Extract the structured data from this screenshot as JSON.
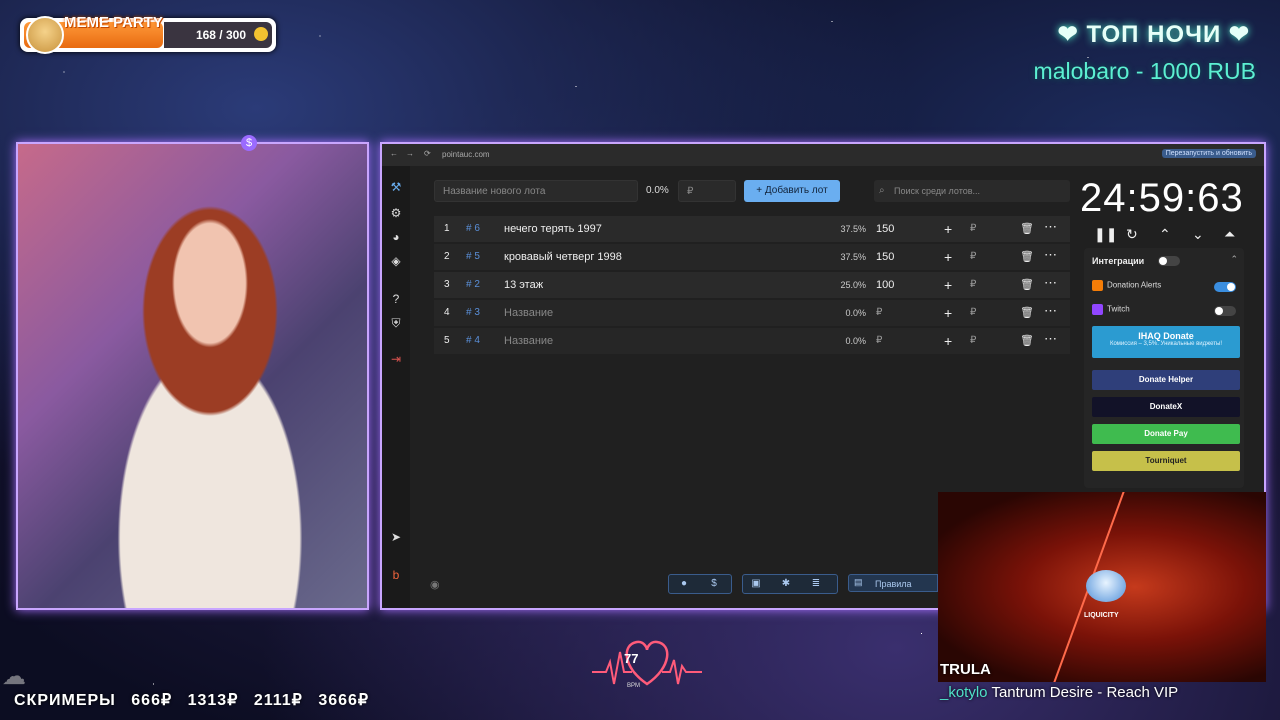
{
  "meme_party": {
    "title": "MEME PARTY",
    "count": "168 / 300",
    "progress": 0.56
  },
  "top_night": {
    "title": "❤ ТОП НОЧИ ❤",
    "donor": "malobaro - 1000 RUB"
  },
  "browser": {
    "url": "pointauc.com",
    "restart_label": "Перезапустить и обновить"
  },
  "auction": {
    "new_lot_placeholder": "Название нового лота",
    "new_lot_percent": "0.0%",
    "amount_placeholder": "₽",
    "add_button": "Добавить лот",
    "search_placeholder": "Поиск среди лотов...",
    "lots": [
      {
        "num": "1",
        "id": "# 6",
        "name": "нечего терять 1997",
        "percent": "37.5%",
        "amount": "150",
        "currency": "₽"
      },
      {
        "num": "2",
        "id": "# 5",
        "name": "кровавый четверг 1998",
        "percent": "37.5%",
        "amount": "150",
        "currency": "₽"
      },
      {
        "num": "3",
        "id": "# 2",
        "name": "13 этаж",
        "percent": "25.0%",
        "amount": "100",
        "currency": "₽"
      },
      {
        "num": "4",
        "id": "# 3",
        "name": "Название",
        "percent": "0.0%",
        "amount": "₽",
        "currency": "₽"
      },
      {
        "num": "5",
        "id": "# 4",
        "name": "Название",
        "percent": "0.0%",
        "amount": "₽",
        "currency": "₽"
      }
    ],
    "rules_label": "Правила"
  },
  "timer": {
    "value": "24:59:63"
  },
  "integrations": {
    "title": "Интеграции",
    "donation_alerts": "Donation Alerts",
    "twitch": "Twitch",
    "ihaq_title": "IHAQ Donate",
    "ihaq_sub": "Комиссия – 3,5%. Уникальные виджеты!",
    "donate_helper": "Donate Helper",
    "donatex": "DonateX",
    "donate_pay": "Donate Pay",
    "tourniquet": "Tourniquet",
    "colors": {
      "ihaq": "#2b9bd1",
      "helper": "#2f3f7a",
      "donatex": "#121228",
      "donatepay": "#3fbb4f",
      "tourniquet": "#c6c04a"
    }
  },
  "music": {
    "logo": "LIQUICITY",
    "artist": "TRULA",
    "requester": "_kotylo",
    "track": "Tantrum Desire - Reach VIP"
  },
  "bpm": {
    "value": "77",
    "label": "BPM"
  },
  "screamers": {
    "title": "СКРИМЕРЫ",
    "tiers": [
      "666₽",
      "1313₽",
      "2111₽",
      "3666₽"
    ]
  },
  "icons": [
    "gavel-icon",
    "gear-icon",
    "pie-chart-icon",
    "layers-icon",
    "help-icon",
    "shield-icon",
    "logout-icon",
    "telegram-icon",
    "boosty-icon",
    "github-icon",
    "dollar-icon",
    "eye-icon"
  ]
}
